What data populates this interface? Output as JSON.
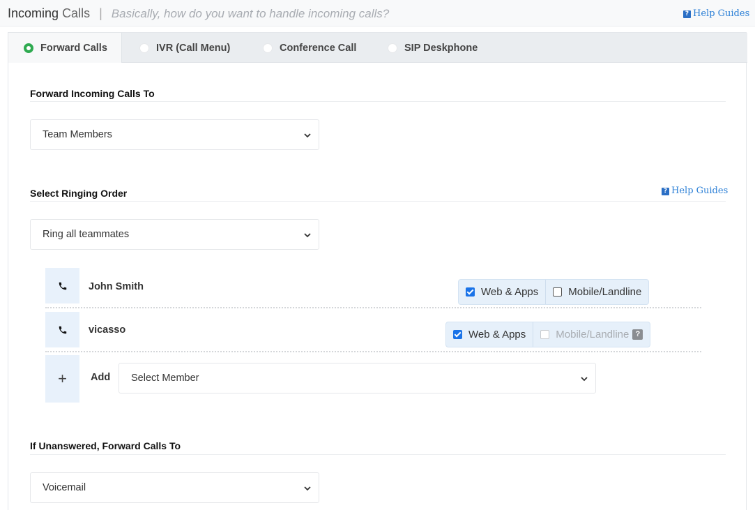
{
  "header": {
    "title_strong": "Incoming",
    "title_light": "Calls",
    "separator": "|",
    "subtitle": "Basically, how do you want to handle incoming calls?",
    "help_label": "Help Guides"
  },
  "tabs": [
    {
      "label": "Forward Calls",
      "selected": true
    },
    {
      "label": "IVR (Call Menu)",
      "selected": false
    },
    {
      "label": "Conference Call",
      "selected": false
    },
    {
      "label": "SIP Deskphone",
      "selected": false
    }
  ],
  "forward_section": {
    "title": "Forward Incoming Calls To",
    "selected": "Team Members"
  },
  "ringing_section": {
    "title": "Select Ringing Order",
    "help_label": "Help Guides",
    "selected": "Ring all teammates"
  },
  "members": [
    {
      "name": "John Smith",
      "web_label": "Web & Apps",
      "web_checked": true,
      "mobile_label": "Mobile/Landline",
      "mobile_checked": false,
      "mobile_disabled": false
    },
    {
      "name": "vicasso",
      "web_label": "Web & Apps",
      "web_checked": true,
      "mobile_label": "Mobile/Landline",
      "mobile_checked": false,
      "mobile_disabled": true
    }
  ],
  "add_member": {
    "plus": "+",
    "label": "Add",
    "placeholder": "Select Member"
  },
  "unanswered_section": {
    "title": "If Unanswered, Forward Calls To",
    "selected": "Voicemail"
  },
  "colors": {
    "accent_green": "#2eaa50",
    "link_blue": "#2b7fd6",
    "checkbox_blue": "#1a73e8"
  }
}
